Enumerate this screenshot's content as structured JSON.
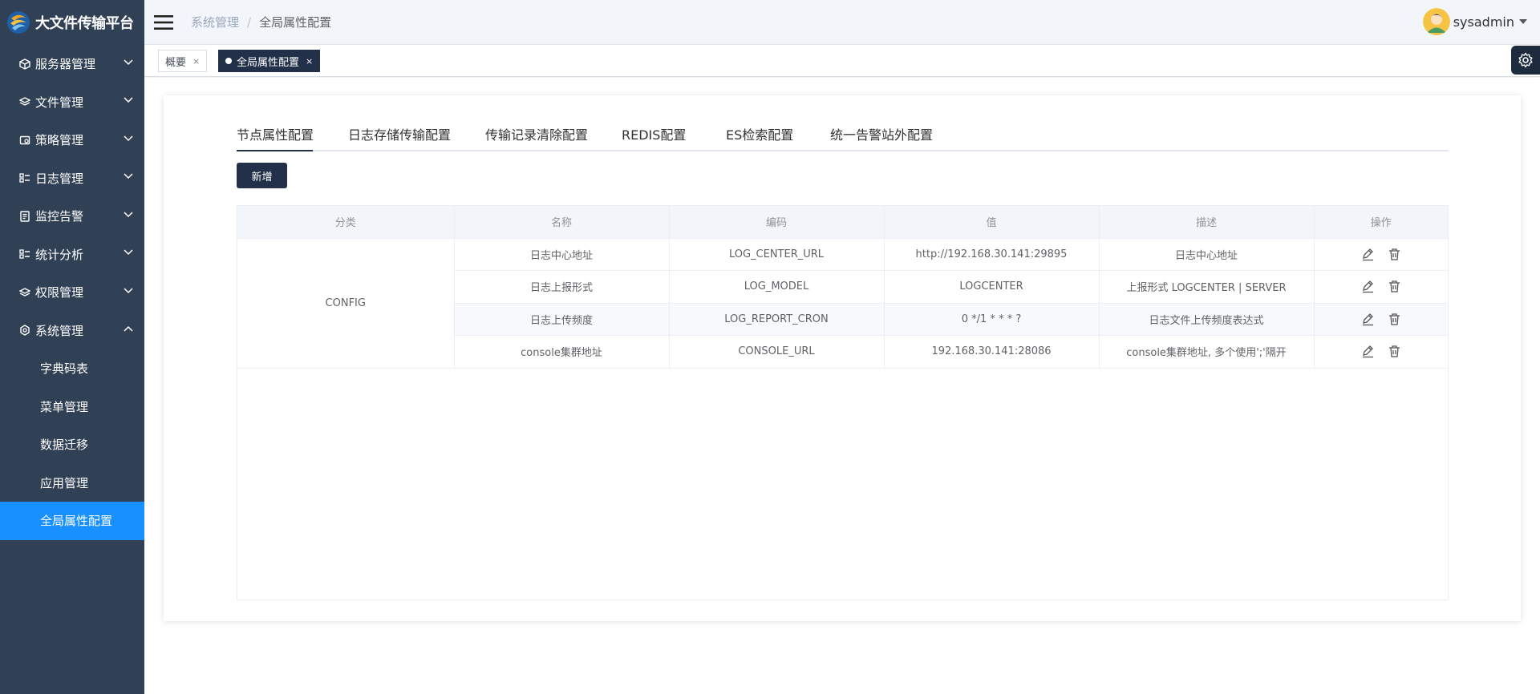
{
  "app": {
    "title": "大文件传输平台"
  },
  "sidebar": {
    "items": [
      {
        "label": "服务器管理",
        "icon": "cube-icon",
        "expanded": false
      },
      {
        "label": "文件管理",
        "icon": "layers-icon",
        "expanded": false
      },
      {
        "label": "策略管理",
        "icon": "policy-icon",
        "expanded": false
      },
      {
        "label": "日志管理",
        "icon": "list-icon",
        "expanded": false
      },
      {
        "label": "监控告警",
        "icon": "monitor-icon",
        "expanded": false
      },
      {
        "label": "统计分析",
        "icon": "chart-list-icon",
        "expanded": false
      },
      {
        "label": "权限管理",
        "icon": "layers-icon",
        "expanded": false
      },
      {
        "label": "系统管理",
        "icon": "gear-icon",
        "expanded": true
      }
    ],
    "subitems": [
      {
        "label": "字典码表"
      },
      {
        "label": "菜单管理"
      },
      {
        "label": "数据迁移"
      },
      {
        "label": "应用管理"
      },
      {
        "label": "全局属性配置",
        "active": true
      }
    ]
  },
  "header": {
    "breadcrumb_parent": "系统管理",
    "breadcrumb_sep": "/",
    "breadcrumb_current": "全局属性配置",
    "username": "sysadmin"
  },
  "tagsbar": {
    "tags": [
      {
        "label": "概要",
        "close": "×"
      },
      {
        "label": "全局属性配置",
        "close": "×",
        "active": true
      }
    ]
  },
  "content": {
    "tabs": [
      {
        "label": "节点属性配置",
        "active": true
      },
      {
        "label": "日志存储传输配置"
      },
      {
        "label": "传输记录清除配置"
      },
      {
        "label": "REDIS配置"
      },
      {
        "label": "ES检索配置"
      },
      {
        "label": "统一告警站外配置"
      }
    ],
    "add_button": "新增",
    "table": {
      "columns": [
        "分类",
        "名称",
        "编码",
        "值",
        "描述",
        "操作"
      ],
      "group": "CONFIG",
      "rows": [
        {
          "name": "日志中心地址",
          "code": "LOG_CENTER_URL",
          "value": "http://192.168.30.141:29895",
          "desc": "日志中心地址"
        },
        {
          "name": "日志上报形式",
          "code": "LOG_MODEL",
          "value": "LOGCENTER",
          "desc": "上报形式 LOGCENTER | SERVER"
        },
        {
          "name": "日志上传频度",
          "code": "LOG_REPORT_CRON",
          "value": "0 */1 * * * ?",
          "desc": "日志文件上传频度表达式"
        },
        {
          "name": "console集群地址",
          "code": "CONSOLE_URL",
          "value": "192.168.30.141:28086",
          "desc": "console集群地址, 多个使用';'隔开"
        }
      ]
    }
  },
  "colors": {
    "sidebar_bg": "#304156",
    "active_menu": "#1890ff",
    "primary_dark": "#22304a"
  }
}
